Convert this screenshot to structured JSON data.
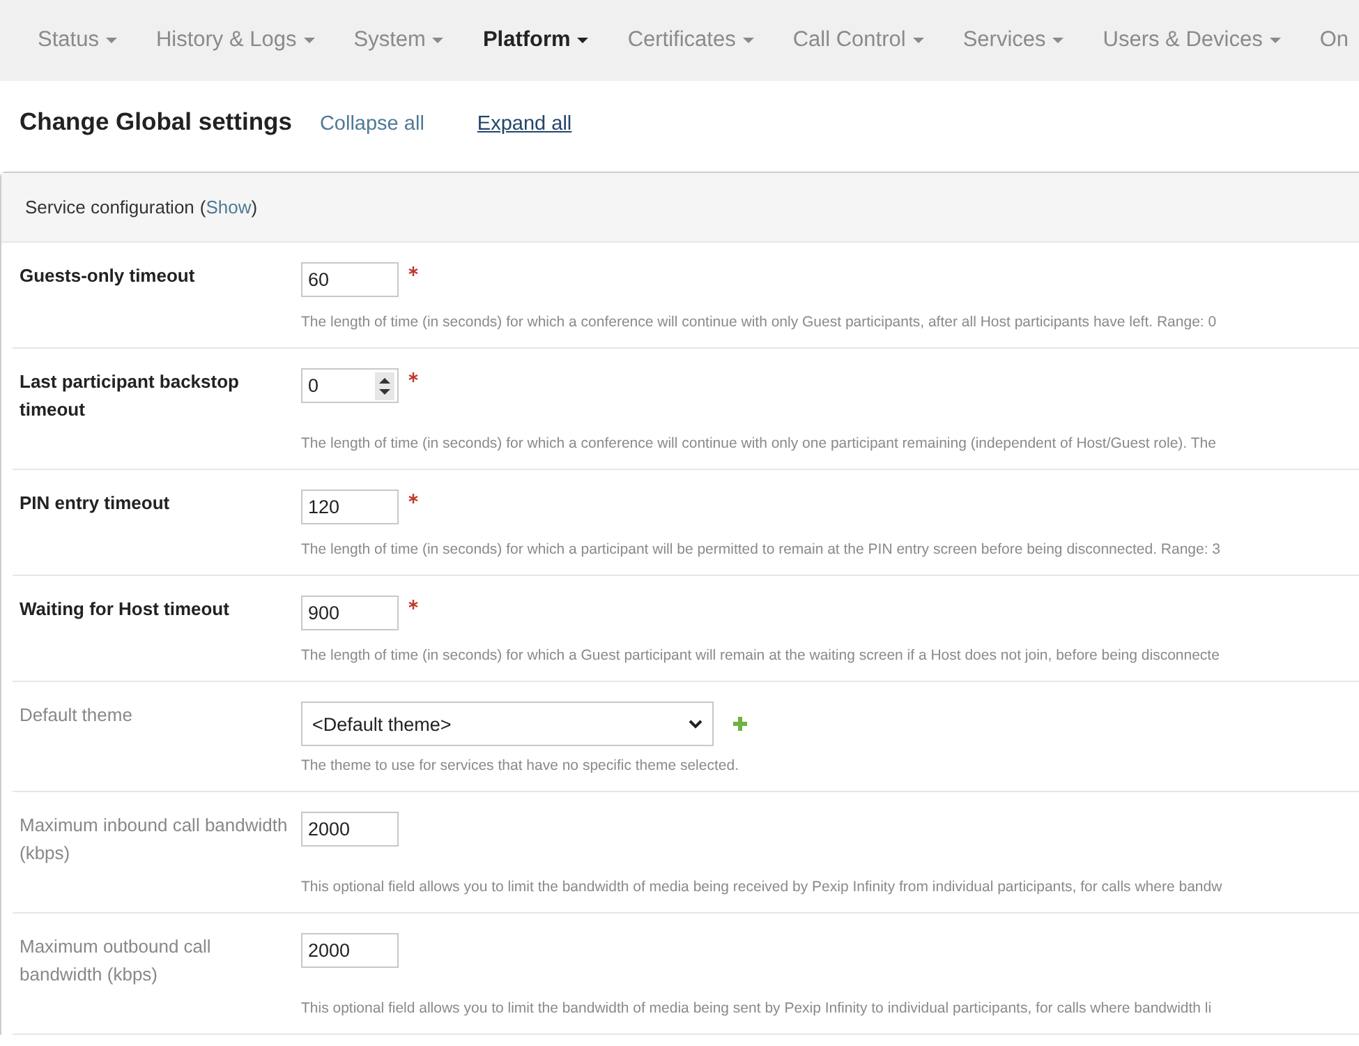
{
  "nav": [
    {
      "label": "Status",
      "selected": false,
      "caret": true
    },
    {
      "label": "History & Logs",
      "selected": false,
      "caret": true
    },
    {
      "label": "System",
      "selected": false,
      "caret": true
    },
    {
      "label": "Platform",
      "selected": true,
      "caret": true
    },
    {
      "label": "Certificates",
      "selected": false,
      "caret": true
    },
    {
      "label": "Call Control",
      "selected": false,
      "caret": true
    },
    {
      "label": "Services",
      "selected": false,
      "caret": true
    },
    {
      "label": "Users & Devices",
      "selected": false,
      "caret": true
    },
    {
      "label": "On",
      "selected": false,
      "caret": false
    }
  ],
  "title": "Change Global settings",
  "collapse_all": "Collapse all",
  "expand_all": "Expand all",
  "section": {
    "title": "Service configuration",
    "paren_open": "(",
    "link": "Show",
    "paren_close": ")"
  },
  "fields": [
    {
      "label": "Guests-only timeout",
      "required": true,
      "kind": "text",
      "value": "60",
      "help": "The length of time (in seconds) for which a conference will continue with only Guest participants, after all Host participants have left. Range: 0"
    },
    {
      "label": "Last participant backstop timeout",
      "required": true,
      "kind": "number",
      "value": "0",
      "help": "The length of time (in seconds) for which a conference will continue with only one participant remaining (independent of Host/Guest role). The"
    },
    {
      "label": "PIN entry timeout",
      "required": true,
      "kind": "text",
      "value": "120",
      "help": "The length of time (in seconds) for which a participant will be permitted to remain at the PIN entry screen before being disconnected. Range: 3"
    },
    {
      "label": "Waiting for Host timeout",
      "required": true,
      "kind": "text",
      "value": "900",
      "help": "The length of time (in seconds) for which a Guest participant will remain at the waiting screen if a Host does not join, before being disconnecte"
    },
    {
      "label": "Default theme",
      "required": false,
      "kind": "select",
      "value": "<Default theme>",
      "help": "The theme to use for services that have no specific theme selected."
    },
    {
      "label": "Maximum inbound call bandwidth (kbps)",
      "required": false,
      "kind": "text",
      "value": "2000",
      "help": "This optional field allows you to limit the bandwidth of media being received by Pexip Infinity from individual participants, for calls where bandw"
    },
    {
      "label": "Maximum outbound call bandwidth (kbps)",
      "required": false,
      "kind": "text",
      "value": "2000",
      "help": "This optional field allows you to limit the bandwidth of media being sent by Pexip Infinity to individual participants, for calls where bandwidth li"
    }
  ]
}
